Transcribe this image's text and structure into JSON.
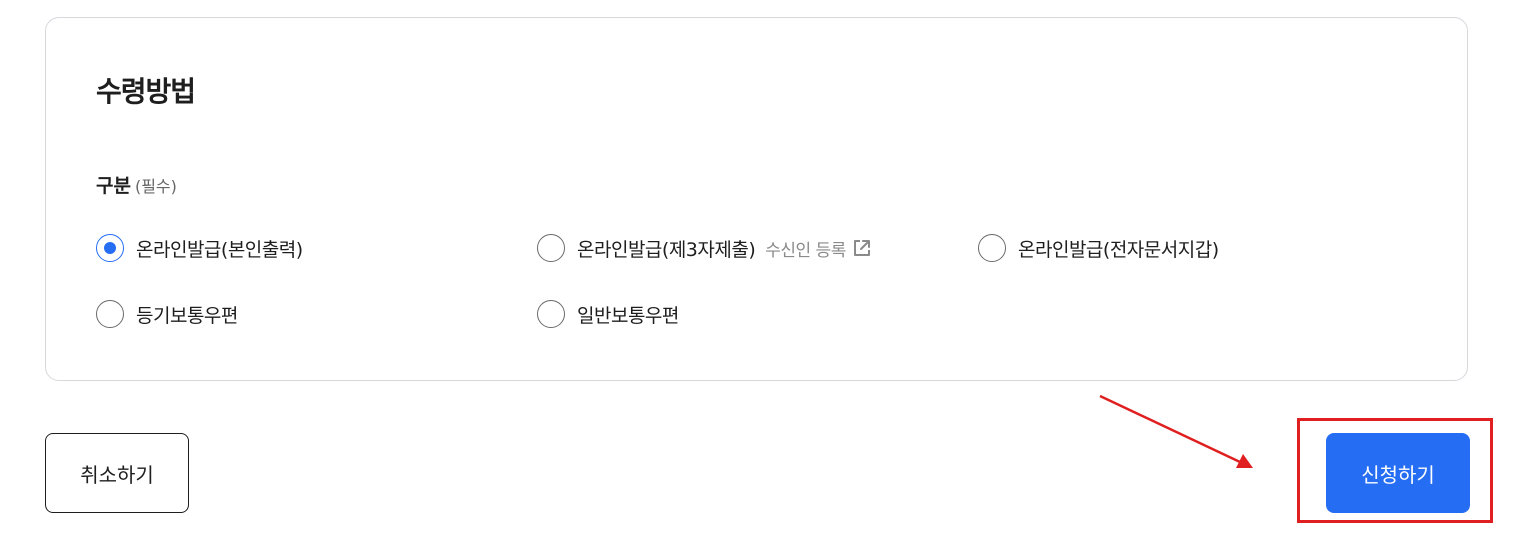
{
  "section": {
    "title": "수령방법",
    "field_label": "구분",
    "required_text": "(필수)"
  },
  "options": [
    {
      "label": "온라인발급(본인출력)",
      "checked": true
    },
    {
      "label": "온라인발급(제3자제출)",
      "checked": false,
      "sub_link": "수신인 등록",
      "sub_icon": "external-link-icon"
    },
    {
      "label": "온라인발급(전자문서지갑)",
      "checked": false
    },
    {
      "label": "등기보통우편",
      "checked": false
    },
    {
      "label": "일반보통우편",
      "checked": false
    }
  ],
  "buttons": {
    "cancel": "취소하기",
    "submit": "신청하기"
  },
  "colors": {
    "accent": "#256ef4",
    "annotation": "#e02020",
    "border": "#d6d8dc"
  }
}
